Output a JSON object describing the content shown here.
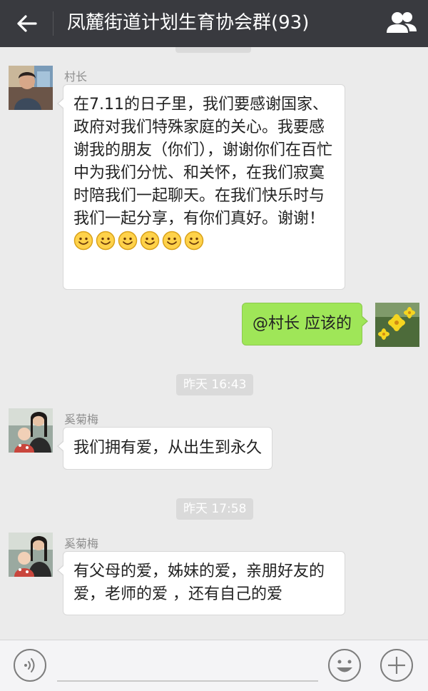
{
  "header": {
    "title": "凤麓街道计划生育协会群(93)",
    "back_icon": "arrow-left-icon",
    "members_icon": "group-members-icon",
    "bg_color": "#393a3f"
  },
  "messages": [
    {
      "side": "left",
      "sender": "村长",
      "text": "在7.11的日子里，我们要感谢国家、政府对我们特殊家庭的关心。我要感谢我的朋友（你们），谢谢你们在百忙中为我们分忧、和关怀，在我们寂寞时陪我们一起聊天。在我们快乐时与我们一起分享，有你们真好。谢谢！",
      "emoji_count": 6
    },
    {
      "side": "right",
      "text": "@村长 应该的"
    },
    {
      "side": "left",
      "sender": "奚菊梅",
      "text": "我们拥有爱，从出生到永久"
    },
    {
      "side": "left",
      "sender": "奚菊梅",
      "text": "有父母的爱，姊妹的爱，亲朋好友的爱，老师的爱 ，还有自己的爱"
    }
  ],
  "timestamps": [
    "昨天 16:43",
    "昨天 17:58"
  ],
  "input_bar": {
    "voice_icon": "voice-icon",
    "emoji_icon": "smiley-icon",
    "plus_icon": "plus-icon",
    "value": ""
  },
  "colors": {
    "chat_bg": "#ebebeb",
    "my_bubble": "#9fe658",
    "other_bubble": "#ffffff"
  }
}
